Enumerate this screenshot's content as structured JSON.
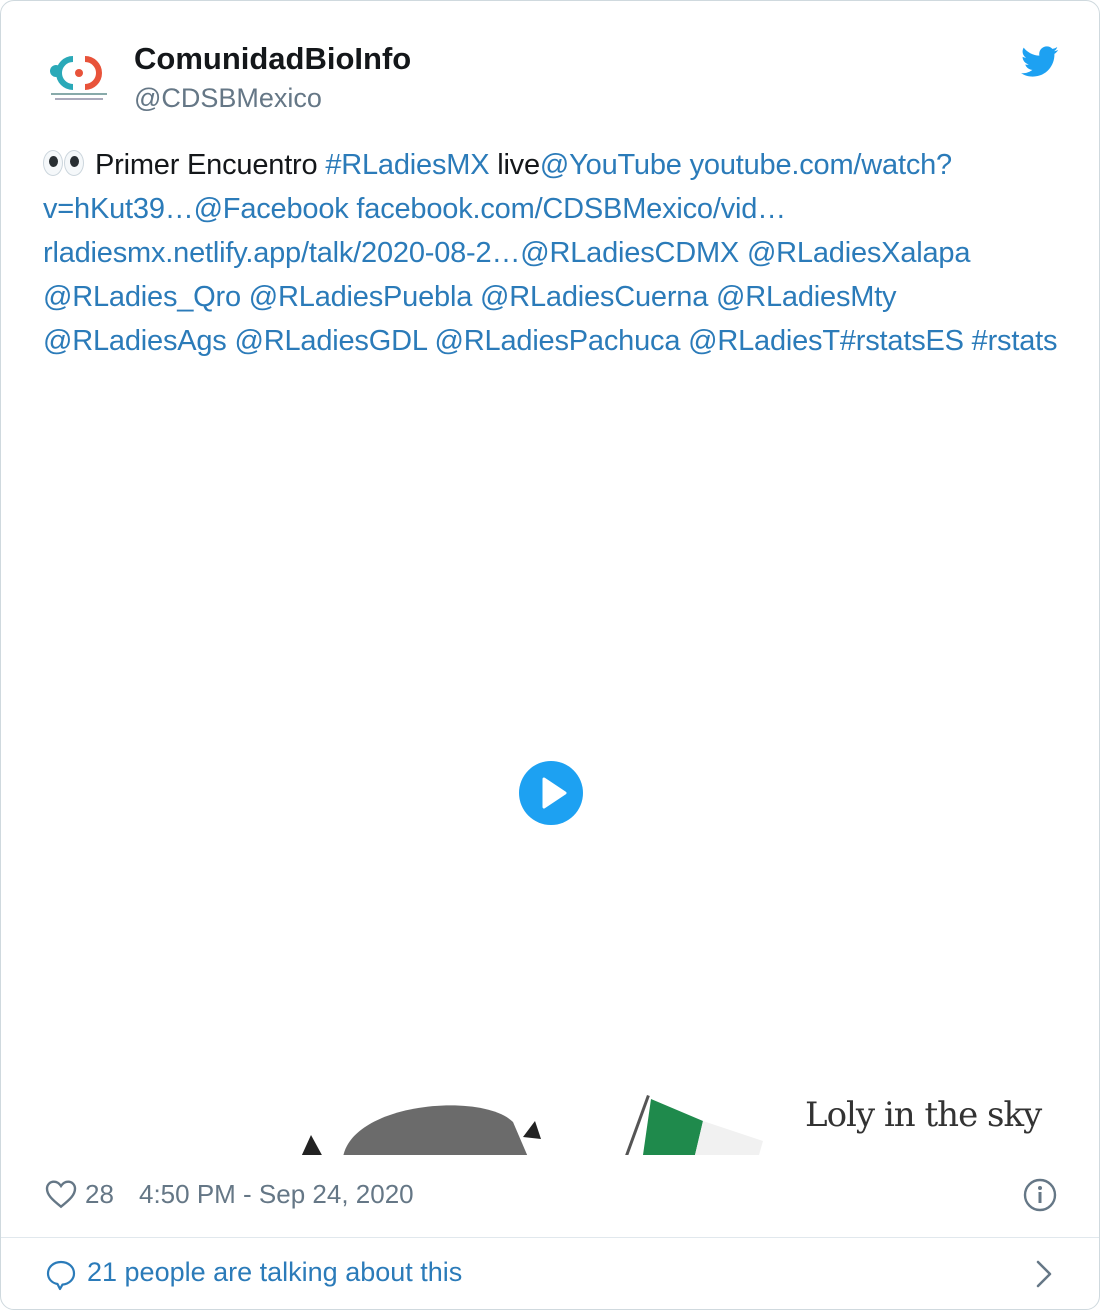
{
  "author": {
    "display_name": "ComunidadBioInfo",
    "handle": "@CDSBMexico"
  },
  "tweet": {
    "segments": [
      {
        "text": "Primer Encuentro ",
        "link": false
      },
      {
        "text": "#RLadiesMX",
        "link": true
      },
      {
        "text": " live",
        "link": false
      },
      {
        "text": "@YouTube",
        "link": true
      },
      {
        "text": " ",
        "link": false
      },
      {
        "text": "youtube.com/watch?v=hKut39…",
        "link": true
      },
      {
        "text": "@Facebook",
        "link": true
      },
      {
        "text": " ",
        "link": false
      },
      {
        "text": "facebook.com/CDSBMexico/vid…",
        "link": true
      },
      {
        "text": " ",
        "link": false
      },
      {
        "text": "rladiesmx.netlify.app/talk/2020-08-2…",
        "link": true
      },
      {
        "text": "@RLadiesCDMX",
        "link": true
      },
      {
        "text": " ",
        "link": false
      },
      {
        "text": "@RLadiesXalapa",
        "link": true
      },
      {
        "text": " ",
        "link": false
      },
      {
        "text": "@RLadies_Qro",
        "link": true
      },
      {
        "text": " ",
        "link": false
      },
      {
        "text": "@RLadiesPuebla",
        "link": true
      },
      {
        "text": " ",
        "link": false
      },
      {
        "text": "@RLadiesCuerna",
        "link": true
      },
      {
        "text": " ",
        "link": false
      },
      {
        "text": "@RLadiesMty",
        "link": true
      },
      {
        "text": " ",
        "link": false
      },
      {
        "text": "@RLadiesAgs",
        "link": true
      },
      {
        "text": " ",
        "link": false
      },
      {
        "text": "@RLadiesGDL",
        "link": true
      },
      {
        "text": " ",
        "link": false
      },
      {
        "text": "@RLadiesPachuca",
        "link": true
      },
      {
        "text": " ",
        "link": false
      },
      {
        "text": "@RLadiesT",
        "link": true
      },
      {
        "text": "#rstatsES",
        "link": true
      },
      {
        "text": " ",
        "link": false
      },
      {
        "text": "#rstats",
        "link": true
      }
    ]
  },
  "media": {
    "caption": "Loly in the sky"
  },
  "footer": {
    "like_count": "28",
    "timestamp": "4:50 PM - Sep 24, 2020"
  },
  "conversation": {
    "label": "21 people are talking about this"
  },
  "icons": {
    "eyes": "eyes-emoji-icon",
    "bird": "twitter-bird-icon",
    "heart": "heart-icon",
    "info": "info-icon",
    "reply": "speech-bubble-icon",
    "chevron": "chevron-right-icon",
    "play": "play-icon"
  },
  "colors": {
    "link": "#2b7bb9",
    "brand": "#1da1f2",
    "text": "#14171a",
    "muted": "#657786"
  }
}
